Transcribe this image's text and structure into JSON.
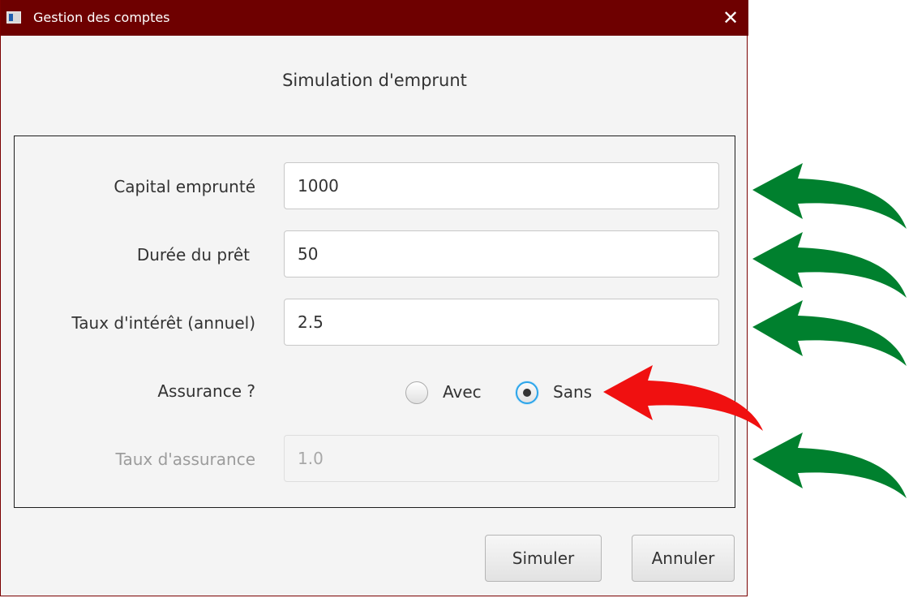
{
  "window": {
    "title": "Gestion des comptes",
    "close_glyph": "✕",
    "icon": "app-window-icon"
  },
  "heading": "Simulation d'emprunt",
  "form": {
    "capital": {
      "label": "Capital emprunté",
      "value": "1000"
    },
    "duree": {
      "label": "Durée du prêt",
      "value": "50"
    },
    "taux_interet": {
      "label": "Taux d'intérêt (annuel)",
      "value": "2.5"
    },
    "assurance": {
      "label": "Assurance ?",
      "options": [
        {
          "label": "Avec",
          "selected": false
        },
        {
          "label": "Sans",
          "selected": true
        }
      ]
    },
    "taux_assurance": {
      "label": "Taux d'assurance",
      "value": "1.0",
      "disabled": true
    }
  },
  "buttons": {
    "simuler": "Simuler",
    "annuler": "Annuler"
  },
  "colors": {
    "titlebar": "#6e0000",
    "arrow_green": "#00802e",
    "arrow_red": "#f01010",
    "focus_blue": "#2aa4ea"
  },
  "annotations": {
    "green_arrows": [
      "capital",
      "duree",
      "taux_interet",
      "taux_assurance"
    ],
    "red_arrow": "assurance-sans"
  }
}
